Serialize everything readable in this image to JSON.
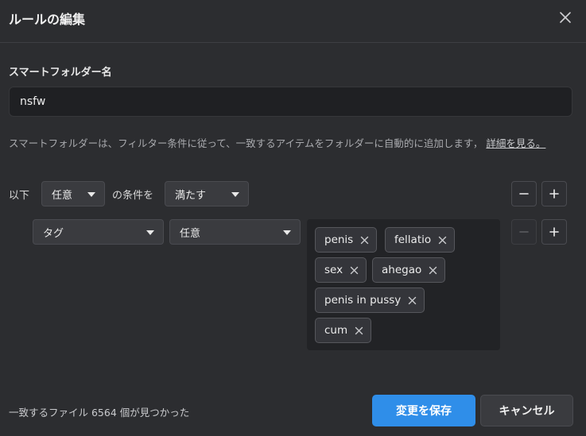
{
  "dialog": {
    "title": "ルールの編集"
  },
  "form": {
    "name_label": "スマートフォルダー名",
    "name_value": "nsfw",
    "description": "スマートフォルダーは、フィルター条件に従って、一致するアイテムをフォルダーに自動的に追加します，",
    "learn_more": "詳細を見る。"
  },
  "conditions": {
    "prefix": "以下",
    "match_select": "任意",
    "middle": "の条件を",
    "mode_select": "満たす"
  },
  "rule": {
    "field_select": "タグ",
    "operator_select": "任意",
    "tags": [
      "penis",
      "fellatio",
      "sex",
      "ahegao",
      "penis in pussy",
      "cum"
    ]
  },
  "footer": {
    "match_count": "一致するファイル 6564 個が見つかった",
    "save_label": "変更を保存",
    "cancel_label": "キャンセル"
  },
  "colors": {
    "background": "#2c2d30",
    "accent": "#2f8ee9",
    "input_bg": "#1f2023"
  },
  "icons": {
    "close": "close-icon",
    "minus": "minus-icon",
    "plus": "plus-icon",
    "caret": "chevron-down-icon",
    "tag_remove": "close-icon"
  }
}
